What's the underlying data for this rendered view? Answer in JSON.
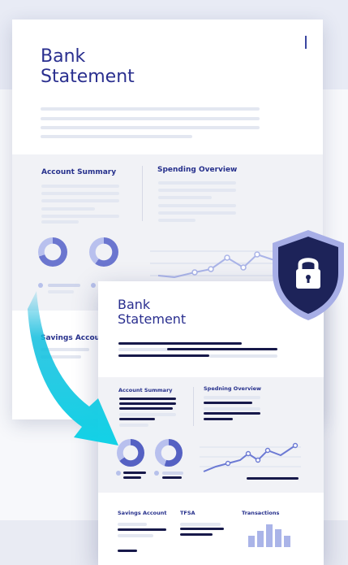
{
  "back_doc": {
    "title_line1": "Bank",
    "title_line2": "Statement",
    "account_summary": "Account Summary",
    "spending_overview": "Spending Overview",
    "savings_account": "Savings Account"
  },
  "front_doc": {
    "title_line1": "Bank",
    "title_line2": "Statement",
    "account_summary": "Account Summary",
    "spending_overview": "Spedning Overview",
    "savings_account": "Savings Account",
    "tfsa": "TFSA",
    "transactions": "Transactions"
  },
  "colors": {
    "title": "#2a2f8f",
    "dark_line": "#17194a",
    "accent_cyan": "#12c6e0",
    "chart_line": "#6c7ad4",
    "shield_dark": "#1d2359",
    "shield_light": "#a7aee6"
  },
  "icons": {
    "lock": "lock-icon",
    "shield": "shield-icon",
    "arrow": "transfer-arrow-icon"
  }
}
